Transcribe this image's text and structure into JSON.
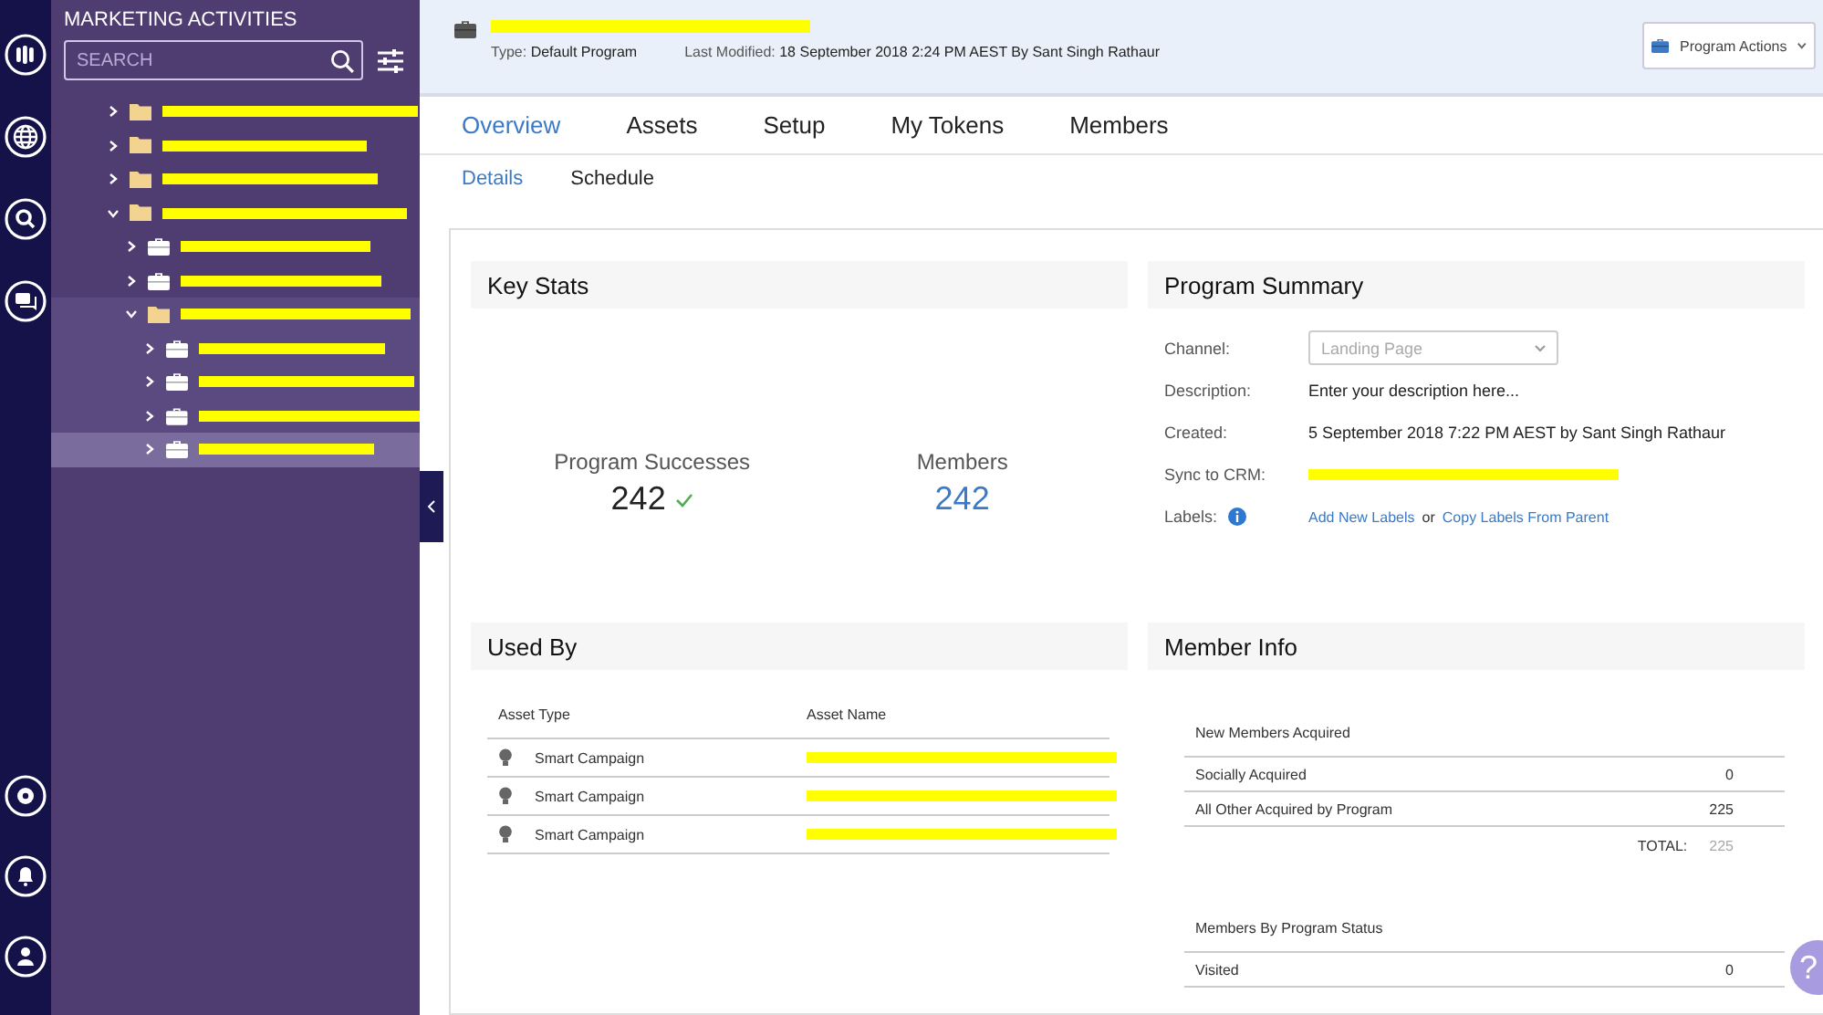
{
  "sidebar": {
    "title": "MARKETING ACTIVITIES",
    "search": {
      "placeholder": "SEARCH"
    },
    "tree": [
      {
        "kind": "folder",
        "expanded": false,
        "selected": false
      },
      {
        "kind": "folder",
        "expanded": false,
        "selected": false
      },
      {
        "kind": "folder",
        "expanded": false,
        "selected": false
      },
      {
        "kind": "folder",
        "expanded": true,
        "selected": false,
        "children": [
          {
            "kind": "program",
            "expanded": false,
            "selected": false
          },
          {
            "kind": "program",
            "expanded": false,
            "selected": false
          },
          {
            "kind": "folder",
            "expanded": true,
            "selected": false,
            "children": [
              {
                "kind": "program",
                "expanded": false,
                "selected": false
              },
              {
                "kind": "program",
                "expanded": false,
                "selected": false
              },
              {
                "kind": "program",
                "expanded": false,
                "selected": false
              },
              {
                "kind": "program",
                "expanded": false,
                "selected": true
              }
            ]
          }
        ]
      }
    ]
  },
  "header": {
    "type_label": "Type:",
    "type_value": "Default Program",
    "modified_label": "Last Modified:",
    "modified_value": "18 September 2018 2:24 PM AEST By Sant Singh Rathaur",
    "actions_button": "Program Actions"
  },
  "tabs": [
    {
      "label": "Overview",
      "selected": true
    },
    {
      "label": "Assets",
      "selected": false
    },
    {
      "label": "Setup",
      "selected": false
    },
    {
      "label": "My Tokens",
      "selected": false
    },
    {
      "label": "Members",
      "selected": false
    }
  ],
  "subtabs": [
    {
      "label": "Details",
      "selected": true
    },
    {
      "label": "Schedule",
      "selected": false
    }
  ],
  "key_stats": {
    "title": "Key Stats",
    "stats": [
      {
        "label": "Program Successes",
        "value": "242",
        "kind": "success"
      },
      {
        "label": "Members",
        "value": "242",
        "kind": "link"
      }
    ]
  },
  "program_summary": {
    "title": "Program Summary",
    "channel_label": "Channel:",
    "channel_value": "Landing Page",
    "description_label": "Description:",
    "description_value": "Enter your description here...",
    "created_label": "Created:",
    "created_value": "5 September 2018 7:22 PM AEST by Sant Singh Rathaur",
    "sync_label": "Sync to CRM:",
    "labels_label": "Labels:",
    "add_labels": "Add New Labels",
    "or": "or",
    "copy_labels": "Copy Labels From Parent"
  },
  "used_by": {
    "title": "Used By",
    "columns": [
      "Asset Type",
      "Asset Name"
    ],
    "rows": [
      {
        "asset_type": "Smart Campaign"
      },
      {
        "asset_type": "Smart Campaign"
      },
      {
        "asset_type": "Smart Campaign"
      }
    ]
  },
  "member_info": {
    "title": "Member Info",
    "acquired_title": "New Members Acquired",
    "acquired_rows": [
      {
        "label": "Socially Acquired",
        "value": "0"
      },
      {
        "label": "All Other Acquired by Program",
        "value": "225"
      }
    ],
    "total_label": "TOTAL:",
    "total_value": "225",
    "status_title": "Members By Program Status",
    "status_rows": [
      {
        "label": "Visited",
        "value": "0"
      }
    ]
  },
  "help_label": "?"
}
